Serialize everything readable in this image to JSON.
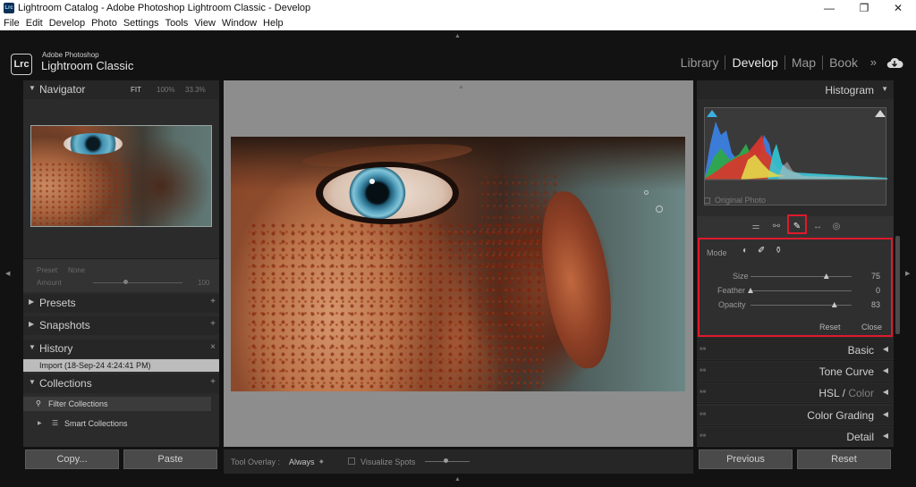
{
  "window": {
    "title": "Lightroom Catalog - Adobe Photoshop Lightroom Classic - Develop",
    "app_icon": "Lrc",
    "controls": {
      "minimize": "—",
      "maximize": "❐",
      "close": "✕"
    }
  },
  "menu": [
    "File",
    "Edit",
    "Develop",
    "Photo",
    "Settings",
    "Tools",
    "View",
    "Window",
    "Help"
  ],
  "identity": {
    "badge": "Lrc",
    "sub": "Adobe Photoshop",
    "name": "Lightroom Classic",
    "modules": [
      "Library",
      "Develop",
      "Map",
      "Book"
    ],
    "active_module": "Develop",
    "more": "»",
    "cloud_icon": "cloud-sync-icon"
  },
  "left": {
    "navigator": {
      "title": "Navigator",
      "zoom": [
        "FIT",
        "100%",
        "33.3%"
      ]
    },
    "preset_box": {
      "preset_label": "Preset",
      "preset_value": "None",
      "amount_label": "Amount",
      "amount_value": "100"
    },
    "panels": [
      {
        "id": "presets",
        "label": "Presets",
        "action": "+"
      },
      {
        "id": "snapshots",
        "label": "Snapshots",
        "action": "+"
      },
      {
        "id": "history",
        "label": "History",
        "action": "×"
      },
      {
        "id": "collections",
        "label": "Collections",
        "action": "+"
      }
    ],
    "history_item": "Import (18-Sep-24 4:24:41 PM)",
    "filter_collections": "Filter Collections",
    "smart_collections": "Smart Collections",
    "buttons": {
      "copy": "Copy...",
      "paste": "Paste"
    }
  },
  "toolbar": {
    "tool_overlay_label": "Tool Overlay :",
    "tool_overlay_value": "Always",
    "visualize_spots": "Visualize Spots"
  },
  "right": {
    "histogram": {
      "title": "Histogram",
      "original_photo": "Original Photo"
    },
    "heal": {
      "mode_label": "Mode",
      "size": {
        "label": "Size",
        "value": 75,
        "max": 100
      },
      "feather": {
        "label": "Feather",
        "value": 0,
        "max": 100
      },
      "opacity": {
        "label": "Opacity",
        "value": 83,
        "max": 100
      },
      "reset": "Reset",
      "close": "Close"
    },
    "sections": [
      "Basic",
      "Tone Curve",
      "HSL",
      "Color",
      "Color Grading",
      "Detail"
    ],
    "buttons": {
      "previous": "Previous",
      "reset": "Reset"
    }
  }
}
